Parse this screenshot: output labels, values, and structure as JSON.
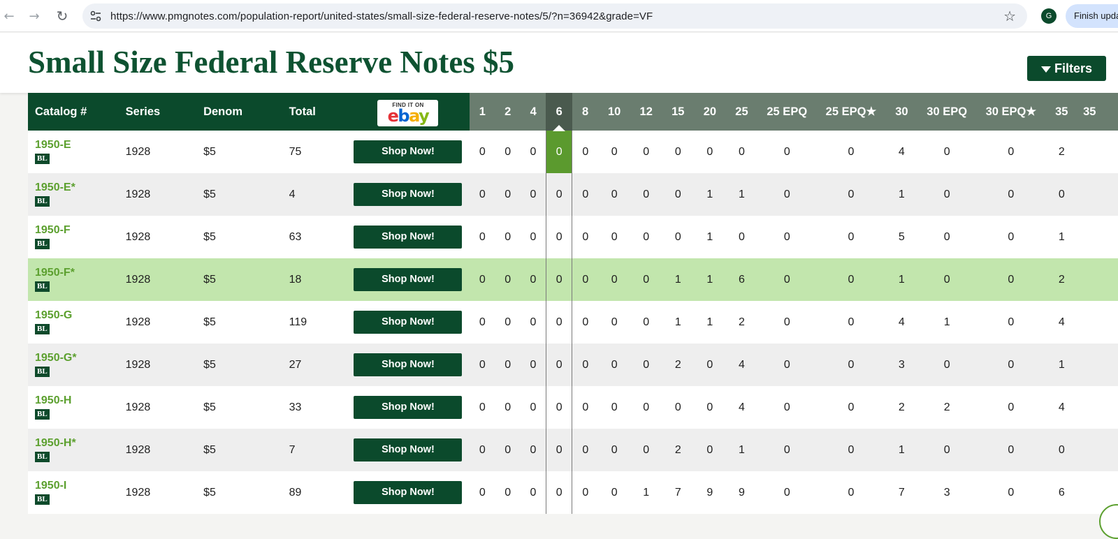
{
  "browser": {
    "url": "https://www.pmgnotes.com/population-report/united-states/small-size-federal-reserve-notes/5/?n=36942&grade=VF",
    "avatar_letter": "G",
    "finish_update_label": "Finish upda",
    "back_icon": "←",
    "forward_icon": "→",
    "reload_icon": "↻",
    "star_icon": "☆"
  },
  "page": {
    "title": "Small Size Federal Reserve Notes $5",
    "filters_label": "Filters"
  },
  "table": {
    "headers": {
      "catalog": "Catalog #",
      "series": "Series",
      "denom": "Denom",
      "total": "Total",
      "ebay_find": "FIND IT ON",
      "ebay_logo": [
        "e",
        "b",
        "a",
        "y"
      ]
    },
    "grade_headers": [
      "1",
      "2",
      "4",
      "6",
      "8",
      "10",
      "12",
      "15",
      "20",
      "25",
      "25 EPQ",
      "25 EPQ★",
      "30",
      "30 EPQ",
      "30 EPQ★",
      "35",
      "35"
    ],
    "selected_grade": "6",
    "shop_label": "Shop Now!",
    "badge": "BL",
    "highlighted_catalog": "1950-F*",
    "rows": [
      {
        "catalog": "1950-E",
        "series": "1928",
        "denom": "$5",
        "total": "75",
        "grades": [
          "0",
          "0",
          "0",
          "0",
          "0",
          "0",
          "0",
          "0",
          "0",
          "0",
          "0",
          "0",
          "4",
          "0",
          "0",
          "2"
        ]
      },
      {
        "catalog": "1950-E*",
        "series": "1928",
        "denom": "$5",
        "total": "4",
        "grades": [
          "0",
          "0",
          "0",
          "0",
          "0",
          "0",
          "0",
          "0",
          "1",
          "1",
          "0",
          "0",
          "1",
          "0",
          "0",
          "0"
        ]
      },
      {
        "catalog": "1950-F",
        "series": "1928",
        "denom": "$5",
        "total": "63",
        "grades": [
          "0",
          "0",
          "0",
          "0",
          "0",
          "0",
          "0",
          "0",
          "1",
          "0",
          "0",
          "0",
          "5",
          "0",
          "0",
          "1"
        ]
      },
      {
        "catalog": "1950-F*",
        "series": "1928",
        "denom": "$5",
        "total": "18",
        "grades": [
          "0",
          "0",
          "0",
          "0",
          "0",
          "0",
          "0",
          "1",
          "1",
          "6",
          "0",
          "0",
          "1",
          "0",
          "0",
          "2"
        ]
      },
      {
        "catalog": "1950-G",
        "series": "1928",
        "denom": "$5",
        "total": "119",
        "grades": [
          "0",
          "0",
          "0",
          "0",
          "0",
          "0",
          "0",
          "1",
          "1",
          "2",
          "0",
          "0",
          "4",
          "1",
          "0",
          "4"
        ]
      },
      {
        "catalog": "1950-G*",
        "series": "1928",
        "denom": "$5",
        "total": "27",
        "grades": [
          "0",
          "0",
          "0",
          "0",
          "0",
          "0",
          "0",
          "2",
          "0",
          "4",
          "0",
          "0",
          "3",
          "0",
          "0",
          "1"
        ]
      },
      {
        "catalog": "1950-H",
        "series": "1928",
        "denom": "$5",
        "total": "33",
        "grades": [
          "0",
          "0",
          "0",
          "0",
          "0",
          "0",
          "0",
          "0",
          "0",
          "4",
          "0",
          "0",
          "2",
          "2",
          "0",
          "4"
        ]
      },
      {
        "catalog": "1950-H*",
        "series": "1928",
        "denom": "$5",
        "total": "7",
        "grades": [
          "0",
          "0",
          "0",
          "0",
          "0",
          "0",
          "0",
          "2",
          "0",
          "1",
          "0",
          "0",
          "1",
          "0",
          "0",
          "0"
        ]
      },
      {
        "catalog": "1950-I",
        "series": "1928",
        "denom": "$5",
        "total": "89",
        "grades": [
          "0",
          "0",
          "0",
          "0",
          "0",
          "0",
          "1",
          "7",
          "9",
          "9",
          "0",
          "0",
          "7",
          "3",
          "0",
          "6"
        ]
      }
    ]
  },
  "colors": {
    "brand_dark_green": "#0b4a2c",
    "link_green": "#5ca02f",
    "highlight_row": "#c2e6ad",
    "grade_header": "#6a7d6f"
  }
}
